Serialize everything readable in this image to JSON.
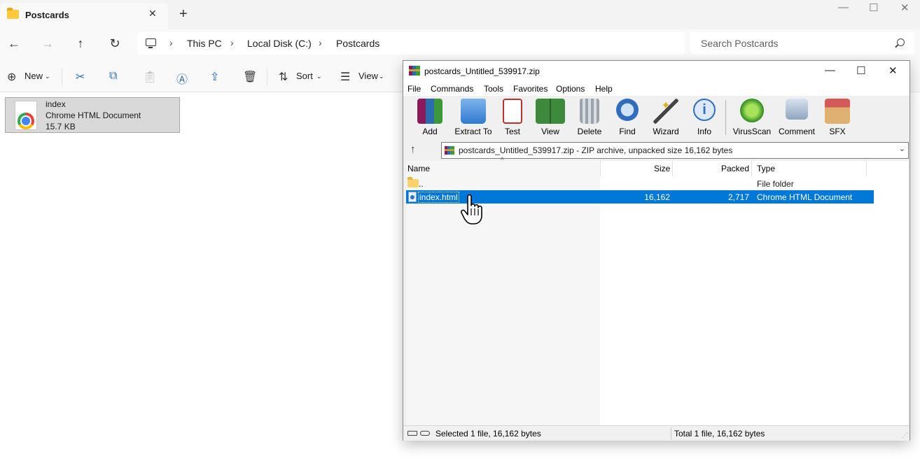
{
  "explorer": {
    "tab_title": "Postcards",
    "breadcrumb": [
      "This PC",
      "Local Disk (C:)",
      "Postcards"
    ],
    "search_placeholder": "Search Postcards",
    "commands": {
      "new": "New",
      "sort": "Sort",
      "view": "View"
    },
    "file": {
      "name": "index",
      "type": "Chrome HTML Document",
      "size": "15.7 KB"
    }
  },
  "winrar": {
    "title": "postcards_Untitled_539917.zip",
    "menu": [
      "File",
      "Commands",
      "Tools",
      "Favorites",
      "Options",
      "Help"
    ],
    "toolbar": [
      "Add",
      "Extract To",
      "Test",
      "View",
      "Delete",
      "Find",
      "Wizard",
      "Info",
      "VirusScan",
      "Comment",
      "SFX"
    ],
    "path": "postcards_Untitled_539917.zip - ZIP archive, unpacked size 16,162 bytes",
    "columns": {
      "name": "Name",
      "size": "Size",
      "packed": "Packed",
      "type": "Type"
    },
    "rows": [
      {
        "name": "..",
        "size": "",
        "packed": "",
        "type": "File folder"
      },
      {
        "name": "index.html",
        "size": "16,162",
        "packed": "2,717",
        "type": "Chrome HTML Document"
      }
    ],
    "status_left": "Selected 1 file, 16,162 bytes",
    "status_right": "Total 1 file, 16,162 bytes"
  },
  "colors": {
    "selection": "#0078d7",
    "explorer_bg": "#f9f9f9",
    "accent_blue": "#2b6fb6"
  }
}
